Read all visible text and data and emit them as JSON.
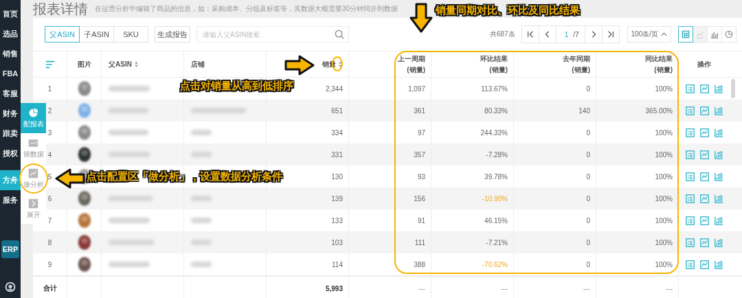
{
  "nav": {
    "items": [
      {
        "label": "首页",
        "selected": false
      },
      {
        "label": "选品",
        "selected": false
      },
      {
        "label": "销售",
        "selected": false
      },
      {
        "label": "FBA",
        "selected": false
      },
      {
        "label": "客服",
        "selected": false
      },
      {
        "label": "财务",
        "selected": false
      },
      {
        "label": "跟卖",
        "selected": false
      },
      {
        "label": "授权",
        "selected": false
      },
      {
        "label": "方舟",
        "selected": true
      },
      {
        "label": "服务",
        "selected": false
      }
    ],
    "badge": "ERP"
  },
  "header": {
    "title": "报表详情",
    "subtitle": "在运营分析中编辑了商品的信息，如：采购成本、分组及标签等，其数据大概需要30分钟同步到数据"
  },
  "config_panel": [
    {
      "kind": "pie",
      "label": "配报表",
      "selected": true
    },
    {
      "kind": "filter",
      "label": "筛数据",
      "selected": false
    },
    {
      "kind": "analysis",
      "label": "做分析",
      "selected": false
    },
    {
      "kind": "expand",
      "label": "展开",
      "selected": false
    }
  ],
  "toolbar": {
    "tabs": [
      {
        "label": "父ASIN",
        "selected": true
      },
      {
        "label": "子ASIN",
        "selected": false
      },
      {
        "label": "SKU",
        "selected": false
      }
    ],
    "report_button": "生成报告",
    "search": {
      "placeholder": "请输入父ASIN搜索"
    },
    "total": "共687条",
    "page": "1",
    "pages": "/7",
    "page_size": "100条/页",
    "views": [
      {
        "kind": "table",
        "selected": true,
        "disabled": false
      },
      {
        "kind": "line",
        "selected": false,
        "disabled": true
      },
      {
        "kind": "bar",
        "selected": false,
        "disabled": false
      },
      {
        "kind": "pie",
        "selected": false,
        "disabled": false
      }
    ]
  },
  "table": {
    "columns": [
      {
        "label": "图片"
      },
      {
        "label": "父ASIN",
        "sortable": true
      },
      {
        "label": "店铺"
      },
      {
        "label": "销量",
        "sortable": true
      },
      {
        "label": "上一周期",
        "sub": "(销量)"
      },
      {
        "label": "环比结果",
        "sub": "(销量)"
      },
      {
        "label": "去年同期",
        "sub": "(销量)"
      },
      {
        "label": "同比结果",
        "sub": "(销量)"
      },
      {
        "label": "操作"
      }
    ],
    "rows": [
      {
        "index": "1",
        "sales": "2,344",
        "prev": "1,097",
        "mom": "113.67%",
        "mom_alert": false,
        "last_year": "0",
        "yoy": "100%"
      },
      {
        "index": "2",
        "sales": "651",
        "prev": "361",
        "mom": "80.33%",
        "mom_alert": false,
        "last_year": "140",
        "yoy": "365.00%"
      },
      {
        "index": "3",
        "sales": "334",
        "prev": "97",
        "mom": "244.33%",
        "mom_alert": false,
        "last_year": "0",
        "yoy": "100%"
      },
      {
        "index": "4",
        "sales": "331",
        "prev": "357",
        "mom": "-7.28%",
        "mom_alert": false,
        "last_year": "0",
        "yoy": "100%"
      },
      {
        "index": "5",
        "sales": "130",
        "prev": "93",
        "mom": "39.78%",
        "mom_alert": false,
        "last_year": "0",
        "yoy": "100%"
      },
      {
        "index": "6",
        "sales": "139",
        "prev": "156",
        "mom": "-10.90%",
        "mom_alert": true,
        "last_year": "0",
        "yoy": "100%"
      },
      {
        "index": "7",
        "sales": "133",
        "prev": "91",
        "mom": "46.15%",
        "mom_alert": false,
        "last_year": "0",
        "yoy": "100%"
      },
      {
        "index": "8",
        "sales": "103",
        "prev": "111",
        "mom": "-7.21%",
        "mom_alert": false,
        "last_year": "0",
        "yoy": "100%"
      },
      {
        "index": "9",
        "sales": "114",
        "prev": "388",
        "mom": "-70.62%",
        "mom_alert": true,
        "last_year": "0",
        "yoy": "100%"
      }
    ],
    "footer": {
      "label": "合计",
      "cells": [
        "5,993",
        "—",
        "—",
        "—",
        "—"
      ]
    }
  },
  "annotations": [
    {
      "kind": "down",
      "text": "销量同期对比、环比及同比结果"
    },
    {
      "kind": "right",
      "text": "点击对销量从高到低排序"
    },
    {
      "kind": "left",
      "text": "点击配置区「做分析」，设置数据分析条件"
    }
  ]
}
